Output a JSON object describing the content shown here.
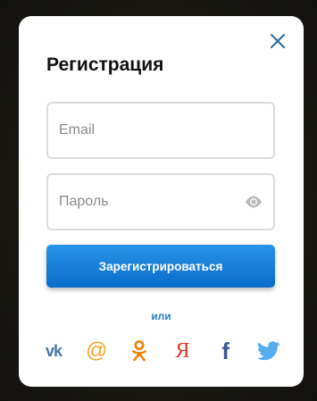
{
  "modal": {
    "title": "Регистрация",
    "close_icon": "close-icon"
  },
  "form": {
    "email": {
      "value": "",
      "placeholder": "Email"
    },
    "password": {
      "value": "",
      "placeholder": "Пароль",
      "toggle_icon": "eye-icon"
    },
    "submit_label": "Зарегистрироваться"
  },
  "divider_text": "или",
  "social": [
    {
      "name": "vk",
      "icon": "vk-icon",
      "glyph": "vk",
      "color": "#4a76a8"
    },
    {
      "name": "mailru",
      "icon": "at-icon",
      "glyph": "@",
      "color": "#f5a623"
    },
    {
      "name": "odnoklassniki",
      "icon": "odnoklassniki-icon",
      "glyph": "",
      "color": "#ee8208"
    },
    {
      "name": "yandex",
      "icon": "yandex-icon",
      "glyph": "Я",
      "color": "#e0312a"
    },
    {
      "name": "facebook",
      "icon": "facebook-icon",
      "glyph": "f",
      "color": "#3b5998"
    },
    {
      "name": "twitter",
      "icon": "twitter-icon",
      "glyph": "",
      "color": "#55acee"
    }
  ],
  "colors": {
    "accent": "#1a7fd6",
    "close": "#2a6a9a",
    "link": "#2a7dc4"
  }
}
